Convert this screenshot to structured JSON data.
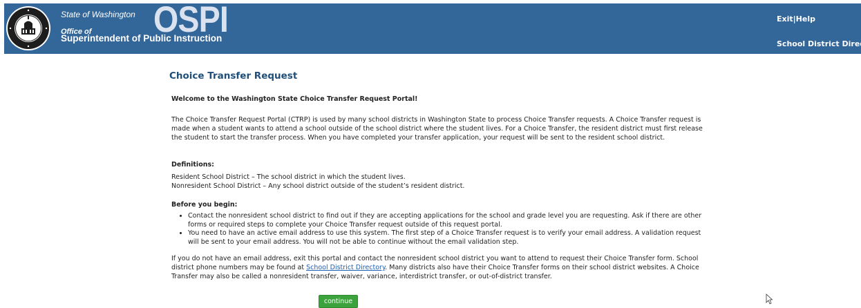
{
  "header": {
    "state_line": "State of Washington",
    "logo_text": "OSPI",
    "office_of": "Office of",
    "superintendent": "Superintendent of Public Instruction",
    "exit_label": "Exit",
    "separator": "|",
    "help_label": "Help",
    "directory_label": "School District Directory",
    "background": "#336699"
  },
  "main": {
    "title": "Choice Transfer Request",
    "welcome": "Welcome to the Washington State Choice Transfer Request Portal!",
    "intro": "The Choice Transfer Request Portal (CTRP) is used by many school districts in Washington State to process Choice Transfer requests. A Choice Transfer request is made when a student wants to attend a school outside of the school district where the student lives. For a Choice Transfer, the resident district must first release the student to start the transfer process. When you have completed your transfer application, your request will be sent to the resident school district.",
    "definitions_heading": "Definitions:",
    "definition_resident": "Resident School District – The school district in which the student lives.",
    "definition_nonresident": "Nonresident School District – Any school district outside of the student’s resident district.",
    "before_heading": "Before you begin:",
    "before_items": [
      "Contact the nonresident school district to find out if they are accepting applications for the school and grade level you are requesting. Ask if there are other forms or required steps to complete your Choice Transfer request outside of this request portal.",
      "You need to have an active email address to use this system. The first step of a Choice Transfer request is to verify your email address. A validation request will be sent to your email address. You will not be able to continue without the email validation step."
    ],
    "no_email_before": "If you do not have an email address, exit this portal and contact the nonresident school district you want to attend to request their Choice Transfer form. School district phone numbers may be found at ",
    "no_email_link": "School District Directory",
    "no_email_after": ". Many districts also have their Choice Transfer forms on their school district websites. A Choice Transfer may also be called a nonresident transfer, waiver, variance, interdistrict transfer, or out-of-district transfer.",
    "continue_label": "continue",
    "title_color": "#1f4e79",
    "button_color": "#3ca33c"
  }
}
